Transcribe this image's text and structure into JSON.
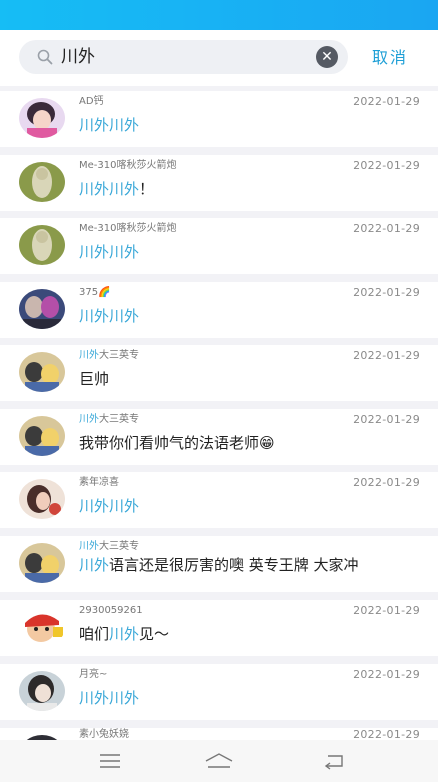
{
  "search": {
    "query": "川外",
    "cancel_label": "取消"
  },
  "results": [
    {
      "sender_hl": "",
      "sender": "AD钙",
      "date": "2022-01-29",
      "msg_hl": "川外川外",
      "msg": ""
    },
    {
      "sender_hl": "",
      "sender": "Me-310喀秋莎火箭炮",
      "date": "2022-01-29",
      "msg_hl": "川外川外",
      "msg": "！"
    },
    {
      "sender_hl": "",
      "sender": "Me-310喀秋莎火箭炮",
      "date": "2022-01-29",
      "msg_hl": "川外川外",
      "msg": ""
    },
    {
      "sender_hl": "",
      "sender": "375🌈",
      "date": "2022-01-29",
      "msg_hl": "川外川外",
      "msg": ""
    },
    {
      "sender_hl": "川外",
      "sender": "大三英专",
      "date": "2022-01-29",
      "msg_hl": "",
      "msg": "巨帅"
    },
    {
      "sender_hl": "川外",
      "sender": "大三英专",
      "date": "2022-01-29",
      "msg_hl": "",
      "msg": "我带你们看帅气的法语老师😁"
    },
    {
      "sender_hl": "",
      "sender": "素年凉喜",
      "date": "2022-01-29",
      "msg_hl": "川外川外",
      "msg": ""
    },
    {
      "sender_hl": "川外",
      "sender": "大三英专",
      "date": "",
      "msg_hl": "川外",
      "msg": "语言还是很厉害的噢 英专王牌 大家冲"
    },
    {
      "sender_hl": "",
      "sender": "2930059261",
      "date": "2022-01-29",
      "msg_pre": "咱们",
      "msg_hl": "川外",
      "msg": "见～"
    },
    {
      "sender_hl": "",
      "sender": "月亮~",
      "date": "2022-01-29",
      "msg_hl": "川外川外",
      "msg": ""
    },
    {
      "sender_hl": "",
      "sender": "素小兔妖娆",
      "date": "2022-01-29",
      "msg_hl": "",
      "msg": ""
    }
  ],
  "nav": {
    "menu_icon": "menu-icon",
    "home_icon": "home-icon",
    "back_icon": "back-icon"
  },
  "colors": {
    "accent": "#1e9fd6",
    "highlight": "#3aa8d8",
    "status_bar": "#16bdf5"
  }
}
